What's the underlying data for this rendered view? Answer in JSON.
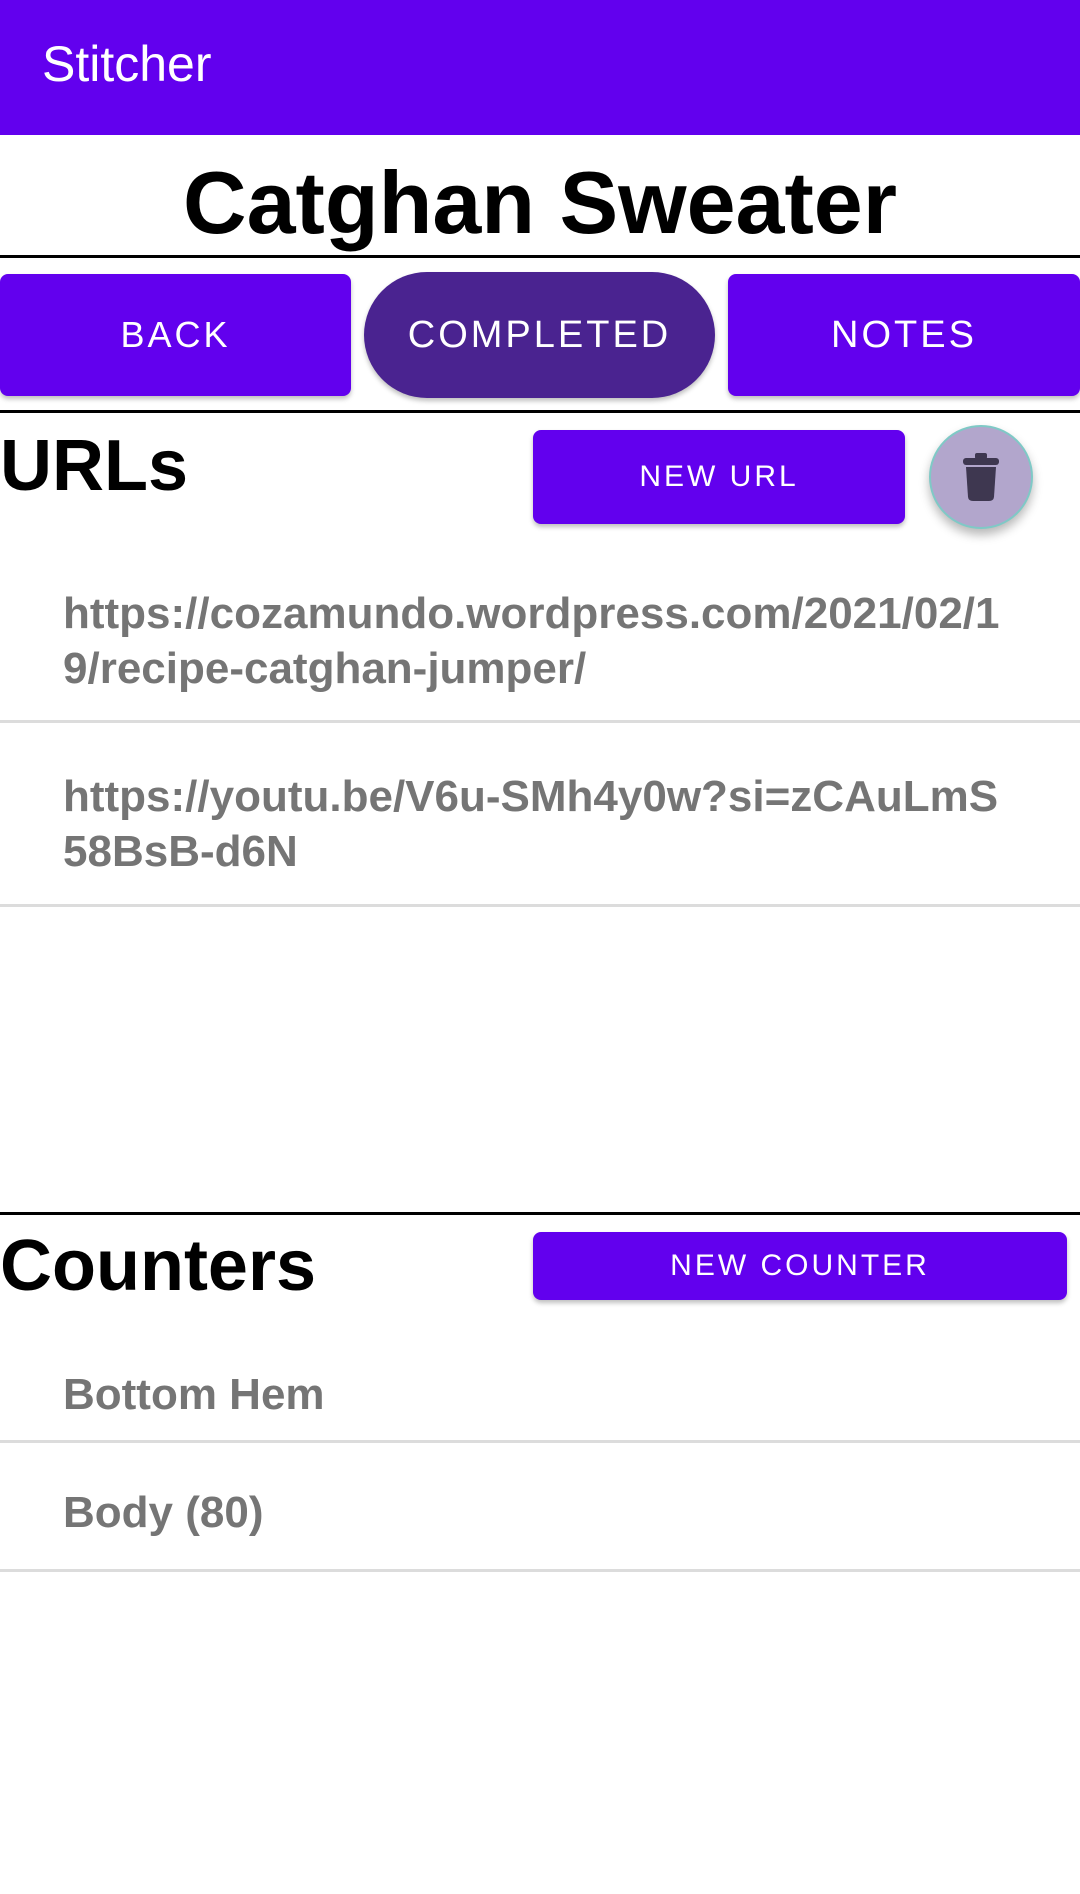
{
  "app_bar": {
    "title": "Stitcher",
    "color": "#6200EE"
  },
  "project": {
    "title": "Catghan Sweater"
  },
  "nav_buttons": {
    "back": "BACK",
    "completed": "COMPLETED",
    "notes": "NOTES"
  },
  "urls": {
    "heading": "URLs",
    "new_button": "NEW URL",
    "delete_icon": "trash-icon",
    "items": [
      "https://cozamundo.wordpress.com/2021/02/19/recipe-catghan-jumper/",
      "https://youtu.be/V6u-SMh4y0w?si=zCAuLmS58BsB-d6N"
    ]
  },
  "counters": {
    "heading": "Counters",
    "new_button": "NEW COUNTER",
    "items": [
      "Bottom Hem",
      "Body (80)"
    ]
  }
}
